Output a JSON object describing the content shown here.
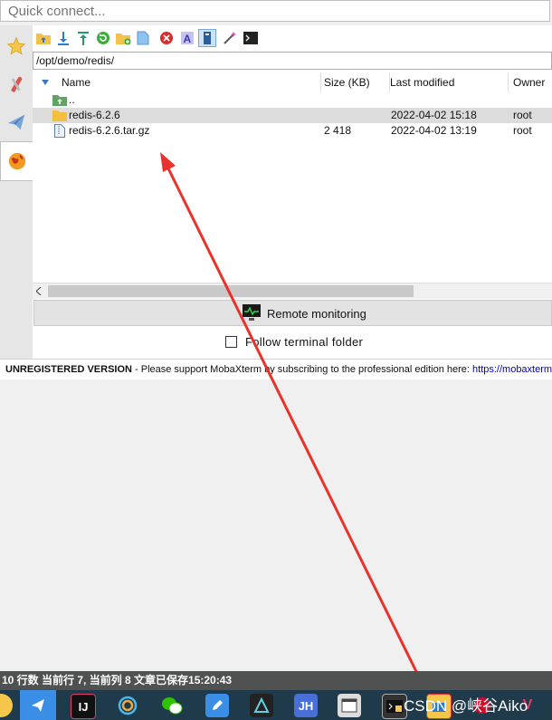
{
  "quick_connect": {
    "placeholder": "Quick connect..."
  },
  "sidebar": {
    "tabs": [
      "sessions-star",
      "tools",
      "macros",
      "sftp"
    ]
  },
  "sftp": {
    "path": "/opt/demo/redis/",
    "columns": {
      "name": "Name",
      "size": "Size (KB)",
      "modified": "Last modified",
      "owner": "Owner"
    },
    "files": [
      {
        "icon": "folder-up-icon",
        "name": "..",
        "size": "",
        "modified": "",
        "owner": ""
      },
      {
        "icon": "folder-icon",
        "name": "redis-6.2.6",
        "size": "",
        "modified": "2022-04-02 15:18",
        "owner": "root"
      },
      {
        "icon": "archive-file-icon",
        "name": "redis-6.2.6.tar.gz",
        "size": "2 418",
        "modified": "2022-04-02 13:19",
        "owner": "root"
      }
    ],
    "remote_monitoring_label": "Remote monitoring",
    "follow_terminal_label": "Follow terminal folder",
    "follow_terminal_checked": false
  },
  "unregistered": {
    "bold": "UNREGISTERED VERSION",
    "text": " - Please support MobaXterm by subscribing to the professional edition here: ",
    "link": "https://mobaxterm"
  },
  "status_bar": {
    "text": "10 行数  当前行 7, 当前列 8  文章已保存15:20:43"
  },
  "taskbar": {
    "items": [
      "chrome-icon",
      "feishu-icon",
      "intellij-icon",
      "browser-icon",
      "wechat-icon",
      "edit-icon",
      "app-icon",
      "jh-icon",
      "window-icon",
      "mobaxterm-icon",
      "drive-icon",
      "red-app-icon",
      "vivo-icon"
    ],
    "jh_label": "JH"
  },
  "watermark": "CSDN @峡谷Aiko",
  "colors": {
    "arrow": "#e8322b",
    "link": "#0000cc",
    "taskbar": "#1f3a4a",
    "status": "#505252"
  }
}
